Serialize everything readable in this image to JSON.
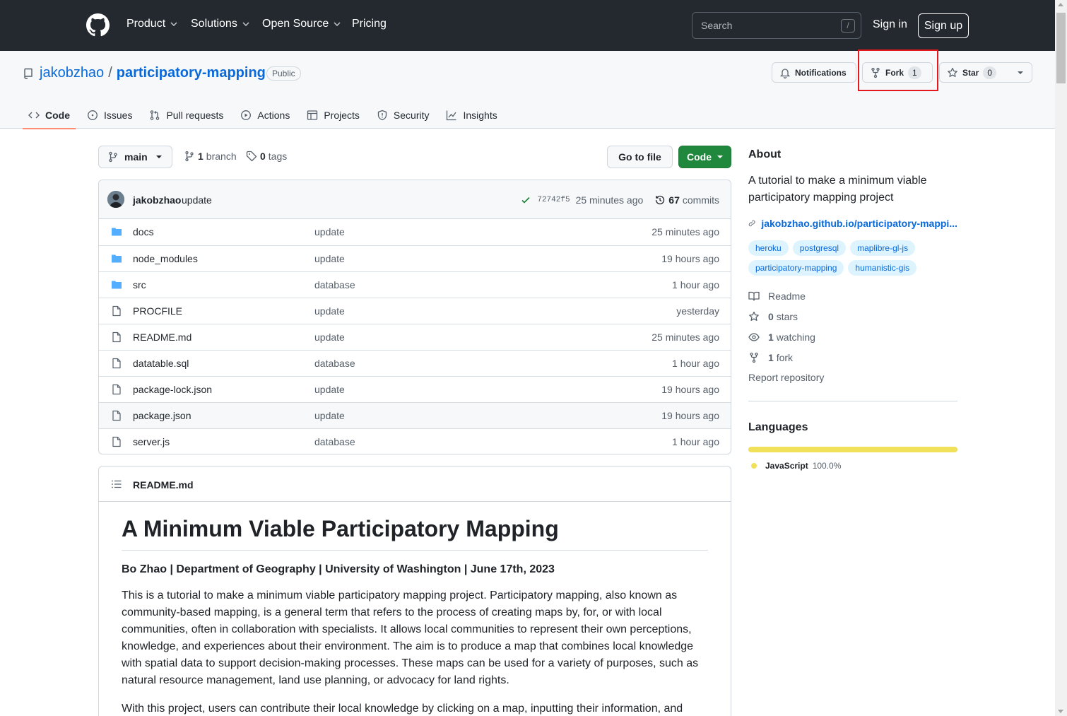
{
  "header": {
    "nav": [
      {
        "label": "Product",
        "has_menu": true
      },
      {
        "label": "Solutions",
        "has_menu": true
      },
      {
        "label": "Open Source",
        "has_menu": true
      },
      {
        "label": "Pricing",
        "has_menu": false
      }
    ],
    "search_placeholder": "Search",
    "search_shortcut": "/",
    "sign_in": "Sign in",
    "sign_up": "Sign up"
  },
  "repo": {
    "owner": "jakobzhao",
    "separator": "/",
    "name": "participatory-mapping",
    "visibility": "Public",
    "notifications_label": "Notifications",
    "fork_label": "Fork",
    "fork_count": "1",
    "star_label": "Star",
    "star_count": "0"
  },
  "tabs": [
    {
      "label": "Code",
      "icon": "code-icon",
      "active": true
    },
    {
      "label": "Issues",
      "icon": "issue-icon",
      "active": false
    },
    {
      "label": "Pull requests",
      "icon": "pull-request-icon",
      "active": false
    },
    {
      "label": "Actions",
      "icon": "play-icon",
      "active": false
    },
    {
      "label": "Projects",
      "icon": "table-icon",
      "active": false
    },
    {
      "label": "Security",
      "icon": "shield-icon",
      "active": false
    },
    {
      "label": "Insights",
      "icon": "graph-icon",
      "active": false
    }
  ],
  "toolbar": {
    "branch": "main",
    "branch_count": "1",
    "branch_word": "branch",
    "tag_count": "0",
    "tag_word": "tags",
    "goto_file": "Go to file",
    "code": "Code"
  },
  "latest_commit": {
    "author": "jakobzhao",
    "message": "update",
    "sha": "72742f5",
    "age": "25 minutes ago",
    "commit_count": "67",
    "commit_word": "commits"
  },
  "files": [
    {
      "name": "docs",
      "type": "folder",
      "message": "update",
      "age": "25 minutes ago"
    },
    {
      "name": "node_modules",
      "type": "folder",
      "message": "update",
      "age": "19 hours ago"
    },
    {
      "name": "src",
      "type": "folder",
      "message": "database",
      "age": "1 hour ago"
    },
    {
      "name": "PROCFILE",
      "type": "file",
      "message": "update",
      "age": "yesterday"
    },
    {
      "name": "README.md",
      "type": "file",
      "message": "update",
      "age": "25 minutes ago"
    },
    {
      "name": "datatable.sql",
      "type": "file",
      "message": "database",
      "age": "1 hour ago"
    },
    {
      "name": "package-lock.json",
      "type": "file",
      "message": "update",
      "age": "19 hours ago"
    },
    {
      "name": "package.json",
      "type": "file",
      "message": "update",
      "age": "19 hours ago"
    },
    {
      "name": "server.js",
      "type": "file",
      "message": "database",
      "age": "1 hour ago"
    }
  ],
  "readme": {
    "filename": "README.md",
    "title": "A Minimum Viable Participatory Mapping",
    "byline": "Bo Zhao | Department of Geography | University of Washington | June 17th, 2023",
    "paragraphs": [
      "This is a tutorial to make a minimum viable participatory mapping project. Participatory mapping, also known as community-based mapping, is a general term that refers to the process of creating maps by, for, or with local communities, often in collaboration with specialists. It allows local communities to represent their own perceptions, knowledge, and experiences about their environment. The aim is to produce a map that combines local knowledge with spatial data to support decision-making processes. These maps can be used for a variety of purposes, such as natural resource management, land use planning, or advocacy for land rights.",
      "With this project, users can contribute their local knowledge by clicking on a map, inputting their information, and"
    ]
  },
  "about": {
    "heading": "About",
    "description": "A tutorial to make a minimum viable participatory mapping project",
    "link": "jakobzhao.github.io/participatory-mappi...",
    "topics": [
      "heroku",
      "postgresql",
      "maplibre-gl-js",
      "participatory-mapping",
      "humanistic-gis"
    ],
    "readme": "Readme",
    "stars_count": "0",
    "stars_word": "stars",
    "watching_count": "1",
    "watching_word": "watching",
    "fork_count": "1",
    "fork_word": "fork",
    "report": "Report repository"
  },
  "languages": {
    "heading": "Languages",
    "items": [
      {
        "name": "JavaScript",
        "percent": "100.0%",
        "color": "#f1e05a"
      }
    ]
  },
  "colors": {
    "header_bg": "#24292f",
    "link_blue": "#0969da",
    "primary_green": "#1f883d",
    "tab_underline": "#fd8c73",
    "highlight_red": "#e5191c"
  }
}
